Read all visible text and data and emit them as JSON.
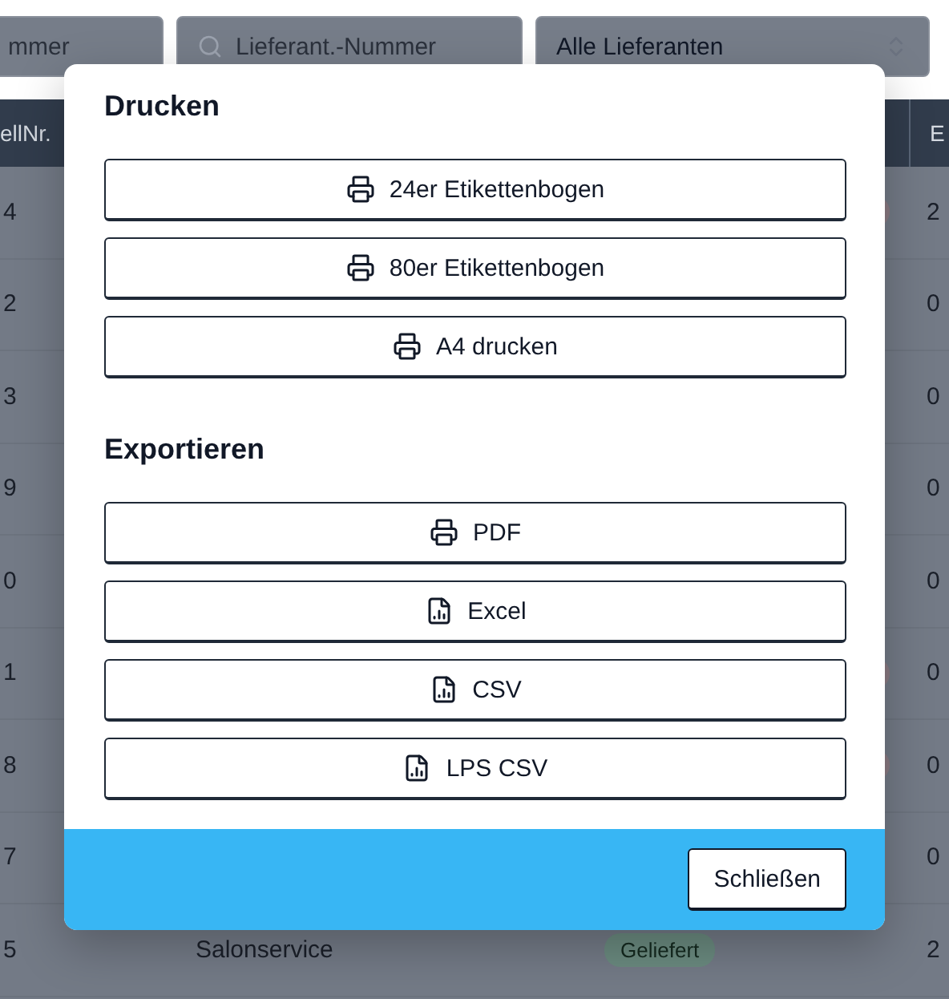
{
  "filters": {
    "number_field": {
      "placeholder": "mmer"
    },
    "supplier_field": {
      "placeholder": "Lieferant.-Nummer"
    },
    "supplier_select": {
      "value": "Alle Lieferanten"
    }
  },
  "table": {
    "columns": [
      "ellNr.",
      "E"
    ],
    "rows": [
      {
        "number": "4",
        "date": "2",
        "flag": true
      },
      {
        "number": "2",
        "date": "0",
        "flag": false
      },
      {
        "number": "3",
        "date": "0",
        "flag": false
      },
      {
        "number": "9",
        "date": "0",
        "flag": false
      },
      {
        "number": "0",
        "date": "0",
        "flag": false
      },
      {
        "number": "1",
        "date": "0",
        "flag": true
      },
      {
        "number": "8",
        "date": "0",
        "flag": true
      },
      {
        "number": "7",
        "date": "0",
        "flag": false
      },
      {
        "number": "5",
        "supplier": "Salonservice",
        "status": "Geliefert",
        "date": "2",
        "flag": false
      }
    ]
  },
  "dialog": {
    "sections": [
      {
        "title": "Drucken",
        "buttons": [
          {
            "label": "24er Etikettenbogen",
            "kind": "print"
          },
          {
            "label": "80er Etikettenbogen",
            "kind": "print"
          },
          {
            "label": "A4 drucken",
            "kind": "print"
          }
        ]
      },
      {
        "title": "Exportieren",
        "buttons": [
          {
            "label": "PDF",
            "kind": "print"
          },
          {
            "label": "Excel",
            "kind": "file"
          },
          {
            "label": "CSV",
            "kind": "file"
          },
          {
            "label": "LPS CSV",
            "kind": "file"
          }
        ]
      }
    ],
    "close_button": "Schließen"
  }
}
